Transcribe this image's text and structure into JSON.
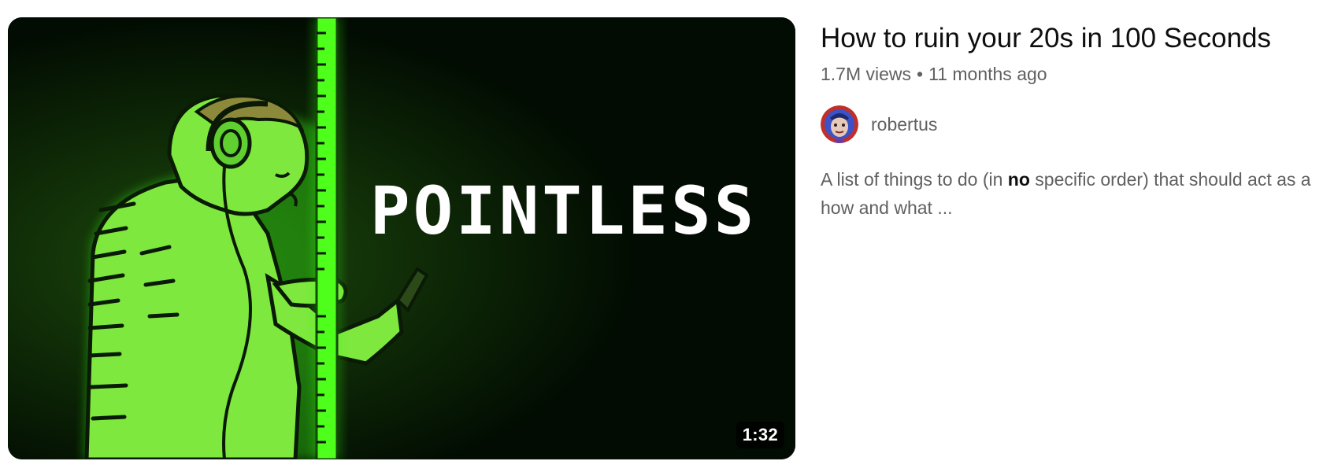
{
  "video": {
    "thumbnail": {
      "overlay_text": "POINTLESS",
      "duration": "1:32",
      "colors": {
        "background": "#020c02",
        "figure_green": "#6fe63a",
        "glow_green": "#39ff14",
        "outline": "#0a1a06"
      }
    },
    "title": "How to ruin your 20s in 100 Seconds",
    "views": "1.7M views",
    "separator": "•",
    "age": "11 months ago",
    "channel": {
      "name": "robertus",
      "avatar_icon": "avatar-icon"
    },
    "description": {
      "before": "A list of things to do (in ",
      "bold": "no",
      "after": " specific order) that should act as a",
      "line2": "how and what ..."
    }
  }
}
